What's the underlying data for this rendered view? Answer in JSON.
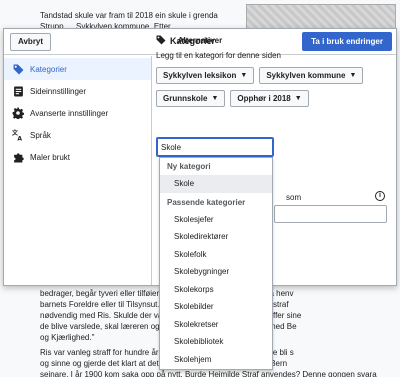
{
  "background": {
    "top_lines": [
      "Tandstad skule var fram til 2018 ein skule i grenda",
      "Strupp … Sykkylven kommune. Etter"
    ],
    "bottom_lines": [
      "bedrager, begår tyveri eller tilføier … nogen Skade, har Læreren å henv",
      "barnets Foreldre eller til Tilsynsut… at den eller de skyldige bliver straf",
      "nødvendig med Ris. Skulde der va… ldige Foreldre, som ikke straffer sine",
      "de blive varslede, skal læreren og… gjøre det – dog må det skje med Be",
      "og Kjærlighed.\"",
      "Ris var vanleg straff for hundre år… e sikra seg mot at borna skulle bli s",
      "og sinne og gjerde det klart at det… nde advarsel for å gi straffa. Bern",
      "seinare. I år 1900 kom saka opp på nytt. Burde Heimilde Straf anvendes? Denne gongen svara kjenne"
    ]
  },
  "dialog": {
    "cancel_label": "Avbryt",
    "title": "Alternativer",
    "apply_label": "Ta i bruk endringer",
    "accent_color": "#3366cc"
  },
  "sidebar": {
    "items": [
      {
        "label": "Kategorier",
        "icon": "tag-icon",
        "active": true
      },
      {
        "label": "Sideinnstillinger",
        "icon": "page-settings-icon",
        "active": false
      },
      {
        "label": "Avanserte innstillinger",
        "icon": "gear-icon",
        "active": false
      },
      {
        "label": "Språk",
        "icon": "language-icon",
        "active": false
      },
      {
        "label": "Maler brukt",
        "icon": "puzzle-icon",
        "active": false
      }
    ]
  },
  "main": {
    "section_title": "Kategorier",
    "section_description": "Legg til en kategori for denne siden",
    "categories": [
      "Sykkylven leksikon",
      "Sykkylven kommune",
      "Grunnskole",
      "Opphør i 2018"
    ],
    "input_value": "Skole",
    "behind_text": "som",
    "info_icon_glyph": "i"
  },
  "dropdown": {
    "new_category_header": "Ny kategori",
    "new_category_item": "Skole",
    "matching_header": "Passende kategorier",
    "matching_items": [
      "Skolesjefer",
      "Skoledirektører",
      "Skolefolk",
      "Skolebygninger",
      "Skolekorps",
      "Skolebilder",
      "Skolekretser",
      "Skolebibliotek",
      "Skolehjem"
    ]
  }
}
